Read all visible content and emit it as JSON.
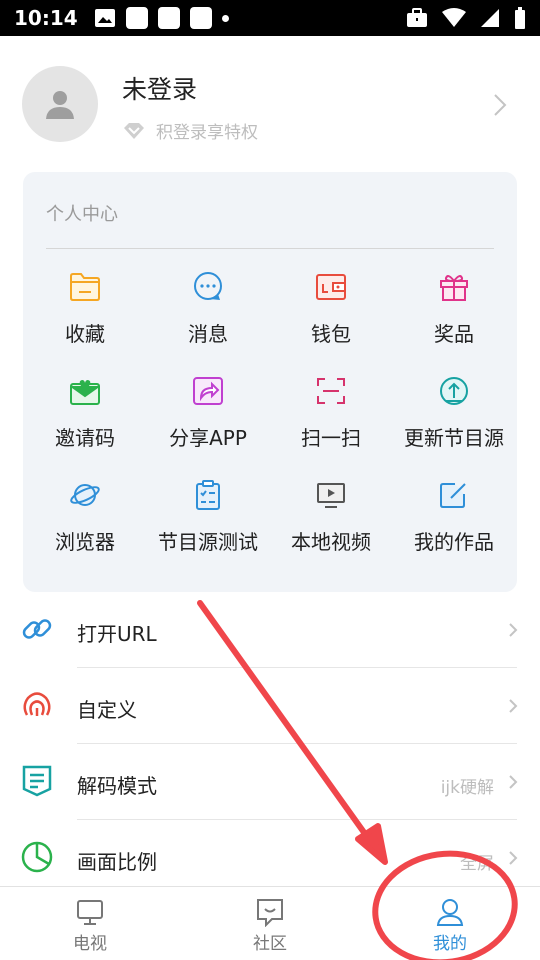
{
  "status_bar": {
    "time": "10:14"
  },
  "profile": {
    "name": "未登录",
    "subtitle": "积登录享特权"
  },
  "personal_center": {
    "title": "个人中心",
    "items": [
      {
        "label": "收藏",
        "icon": "folder-icon",
        "color": "#f5a623"
      },
      {
        "label": "消息",
        "icon": "message-bubble-icon",
        "color": "#2f8fd8"
      },
      {
        "label": "钱包",
        "icon": "wallet-icon",
        "color": "#e84c3d"
      },
      {
        "label": "奖品",
        "icon": "gift-icon",
        "color": "#e0338a"
      },
      {
        "label": "邀请码",
        "icon": "invite-envelope-icon",
        "color": "#2bb24c"
      },
      {
        "label": "分享APP",
        "icon": "share-icon",
        "color": "#c040d0"
      },
      {
        "label": "扫一扫",
        "icon": "scan-icon",
        "color": "#d6336c"
      },
      {
        "label": "更新节目源",
        "icon": "update-upload-icon",
        "color": "#17a2a2"
      },
      {
        "label": "浏览器",
        "icon": "planet-browser-icon",
        "color": "#2f8fd8"
      },
      {
        "label": "节目源测试",
        "icon": "clipboard-test-icon",
        "color": "#2f8fd8"
      },
      {
        "label": "本地视频",
        "icon": "monitor-play-icon",
        "color": "#555555"
      },
      {
        "label": "我的作品",
        "icon": "edit-square-icon",
        "color": "#2f8fd8"
      }
    ]
  },
  "menu": [
    {
      "label": "打开URL",
      "value": "",
      "icon": "link-icon",
      "color": "#2f8fd8"
    },
    {
      "label": "自定义",
      "value": "",
      "icon": "custom-rss-icon",
      "color": "#e84c3d"
    },
    {
      "label": "解码模式",
      "value": "ijk硬解",
      "icon": "decode-mode-icon",
      "color": "#17a2a2"
    },
    {
      "label": "画面比例",
      "value": "全屏",
      "icon": "pie-ratio-icon",
      "color": "#2bb24c"
    }
  ],
  "tabbar": {
    "tabs": [
      {
        "label": "电视",
        "icon": "tv-icon",
        "active": false
      },
      {
        "label": "社区",
        "icon": "chat-community-icon",
        "active": false
      },
      {
        "label": "我的",
        "icon": "user-icon",
        "active": true
      }
    ]
  },
  "colors": {
    "accent": "#2f8fd8",
    "annotation": "#f0464b"
  }
}
